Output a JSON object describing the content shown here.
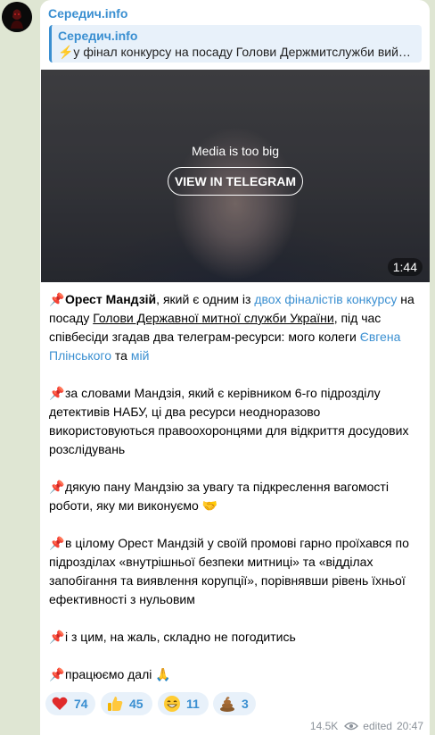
{
  "channel": {
    "name": "Середич.info"
  },
  "reply": {
    "title": "Середич.info",
    "text": "⚡у фінал конкурсу на посаду Голови Держмитслужби вийшли..."
  },
  "media": {
    "message": "Media is too big",
    "button_label": "VIEW IN TELEGRAM",
    "duration": "1:44"
  },
  "post": {
    "p1": {
      "name": "Орест Мандзій",
      "t1": ", який є одним із ",
      "link1": "двох фіналістів конкурсу",
      "t2": " на посаду ",
      "link2": "Голови Державної митної служби України",
      "t3": ", під час співбесіди згадав два телеграм-ресурси: мого колеги ",
      "link3": "Євгена Плінського",
      "t4": " та ",
      "link4": "мій"
    },
    "p2": "за словами Мандзія, який є керівником 6-го підрозділу детективів НАБУ, ці два ресурси неодноразово використовуються правоохоронцями для відкриття досудових розслідувань",
    "p3": "дякую пану Мандзію за увагу та підкреслення вагомості роботи, яку ми виконуємо",
    "p4": "в цілому Орест Мандзій у своїй промові гарно проїхався по підрозділах «внутрішньої безпеки митниці» та «відділах запобігання та виявлення корупції», порівнявши рівень їхньої ефективності з нульовим",
    "p5": "і з цим, на жаль, складно не погодитись",
    "p6": "працюємо далі"
  },
  "reactions": [
    {
      "emoji": "heart-icon",
      "count": "74"
    },
    {
      "emoji": "thumbs-up-icon",
      "count": "45"
    },
    {
      "emoji": "grin-icon",
      "count": "11"
    },
    {
      "emoji": "poop-icon",
      "count": "3"
    }
  ],
  "meta": {
    "views": "14.5K",
    "edited": "edited",
    "time": "20:47"
  },
  "colors": {
    "accent": "#3a8fd1",
    "background": "#dfe6d3",
    "reaction_bg": "#e8f1fa"
  }
}
